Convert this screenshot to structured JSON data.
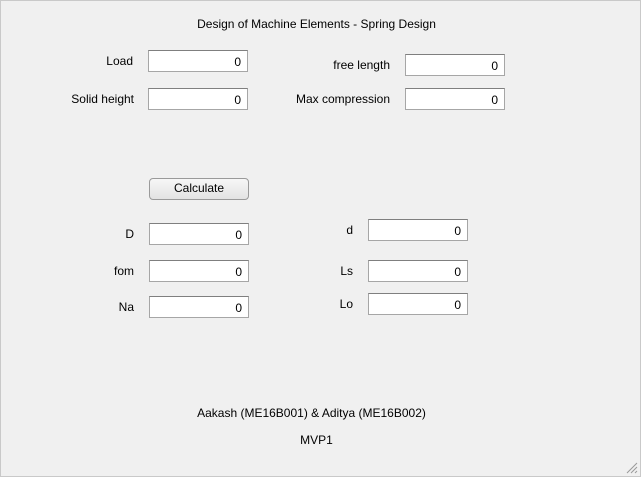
{
  "title": "Design of Machine Elements - Spring Design",
  "inputs": {
    "load": {
      "label": "Load",
      "value": "0"
    },
    "solid_height": {
      "label": "Solid height",
      "value": "0"
    },
    "free_length": {
      "label": "free length",
      "value": "0"
    },
    "max_compression": {
      "label": "Max compression",
      "value": "0"
    }
  },
  "calculate_label": "Calculate",
  "outputs": {
    "D": {
      "label": "D",
      "value": "0"
    },
    "fom": {
      "label": "fom",
      "value": "0"
    },
    "Na": {
      "label": "Na",
      "value": "0"
    },
    "d": {
      "label": "d",
      "value": "0"
    },
    "Ls": {
      "label": "Ls",
      "value": "0"
    },
    "Lo": {
      "label": "Lo",
      "value": "0"
    }
  },
  "authors": "Aakash (ME16B001) & Aditya (ME16B002)",
  "version": "MVP1",
  "icons": {
    "resize": "resize-grip-icon"
  }
}
